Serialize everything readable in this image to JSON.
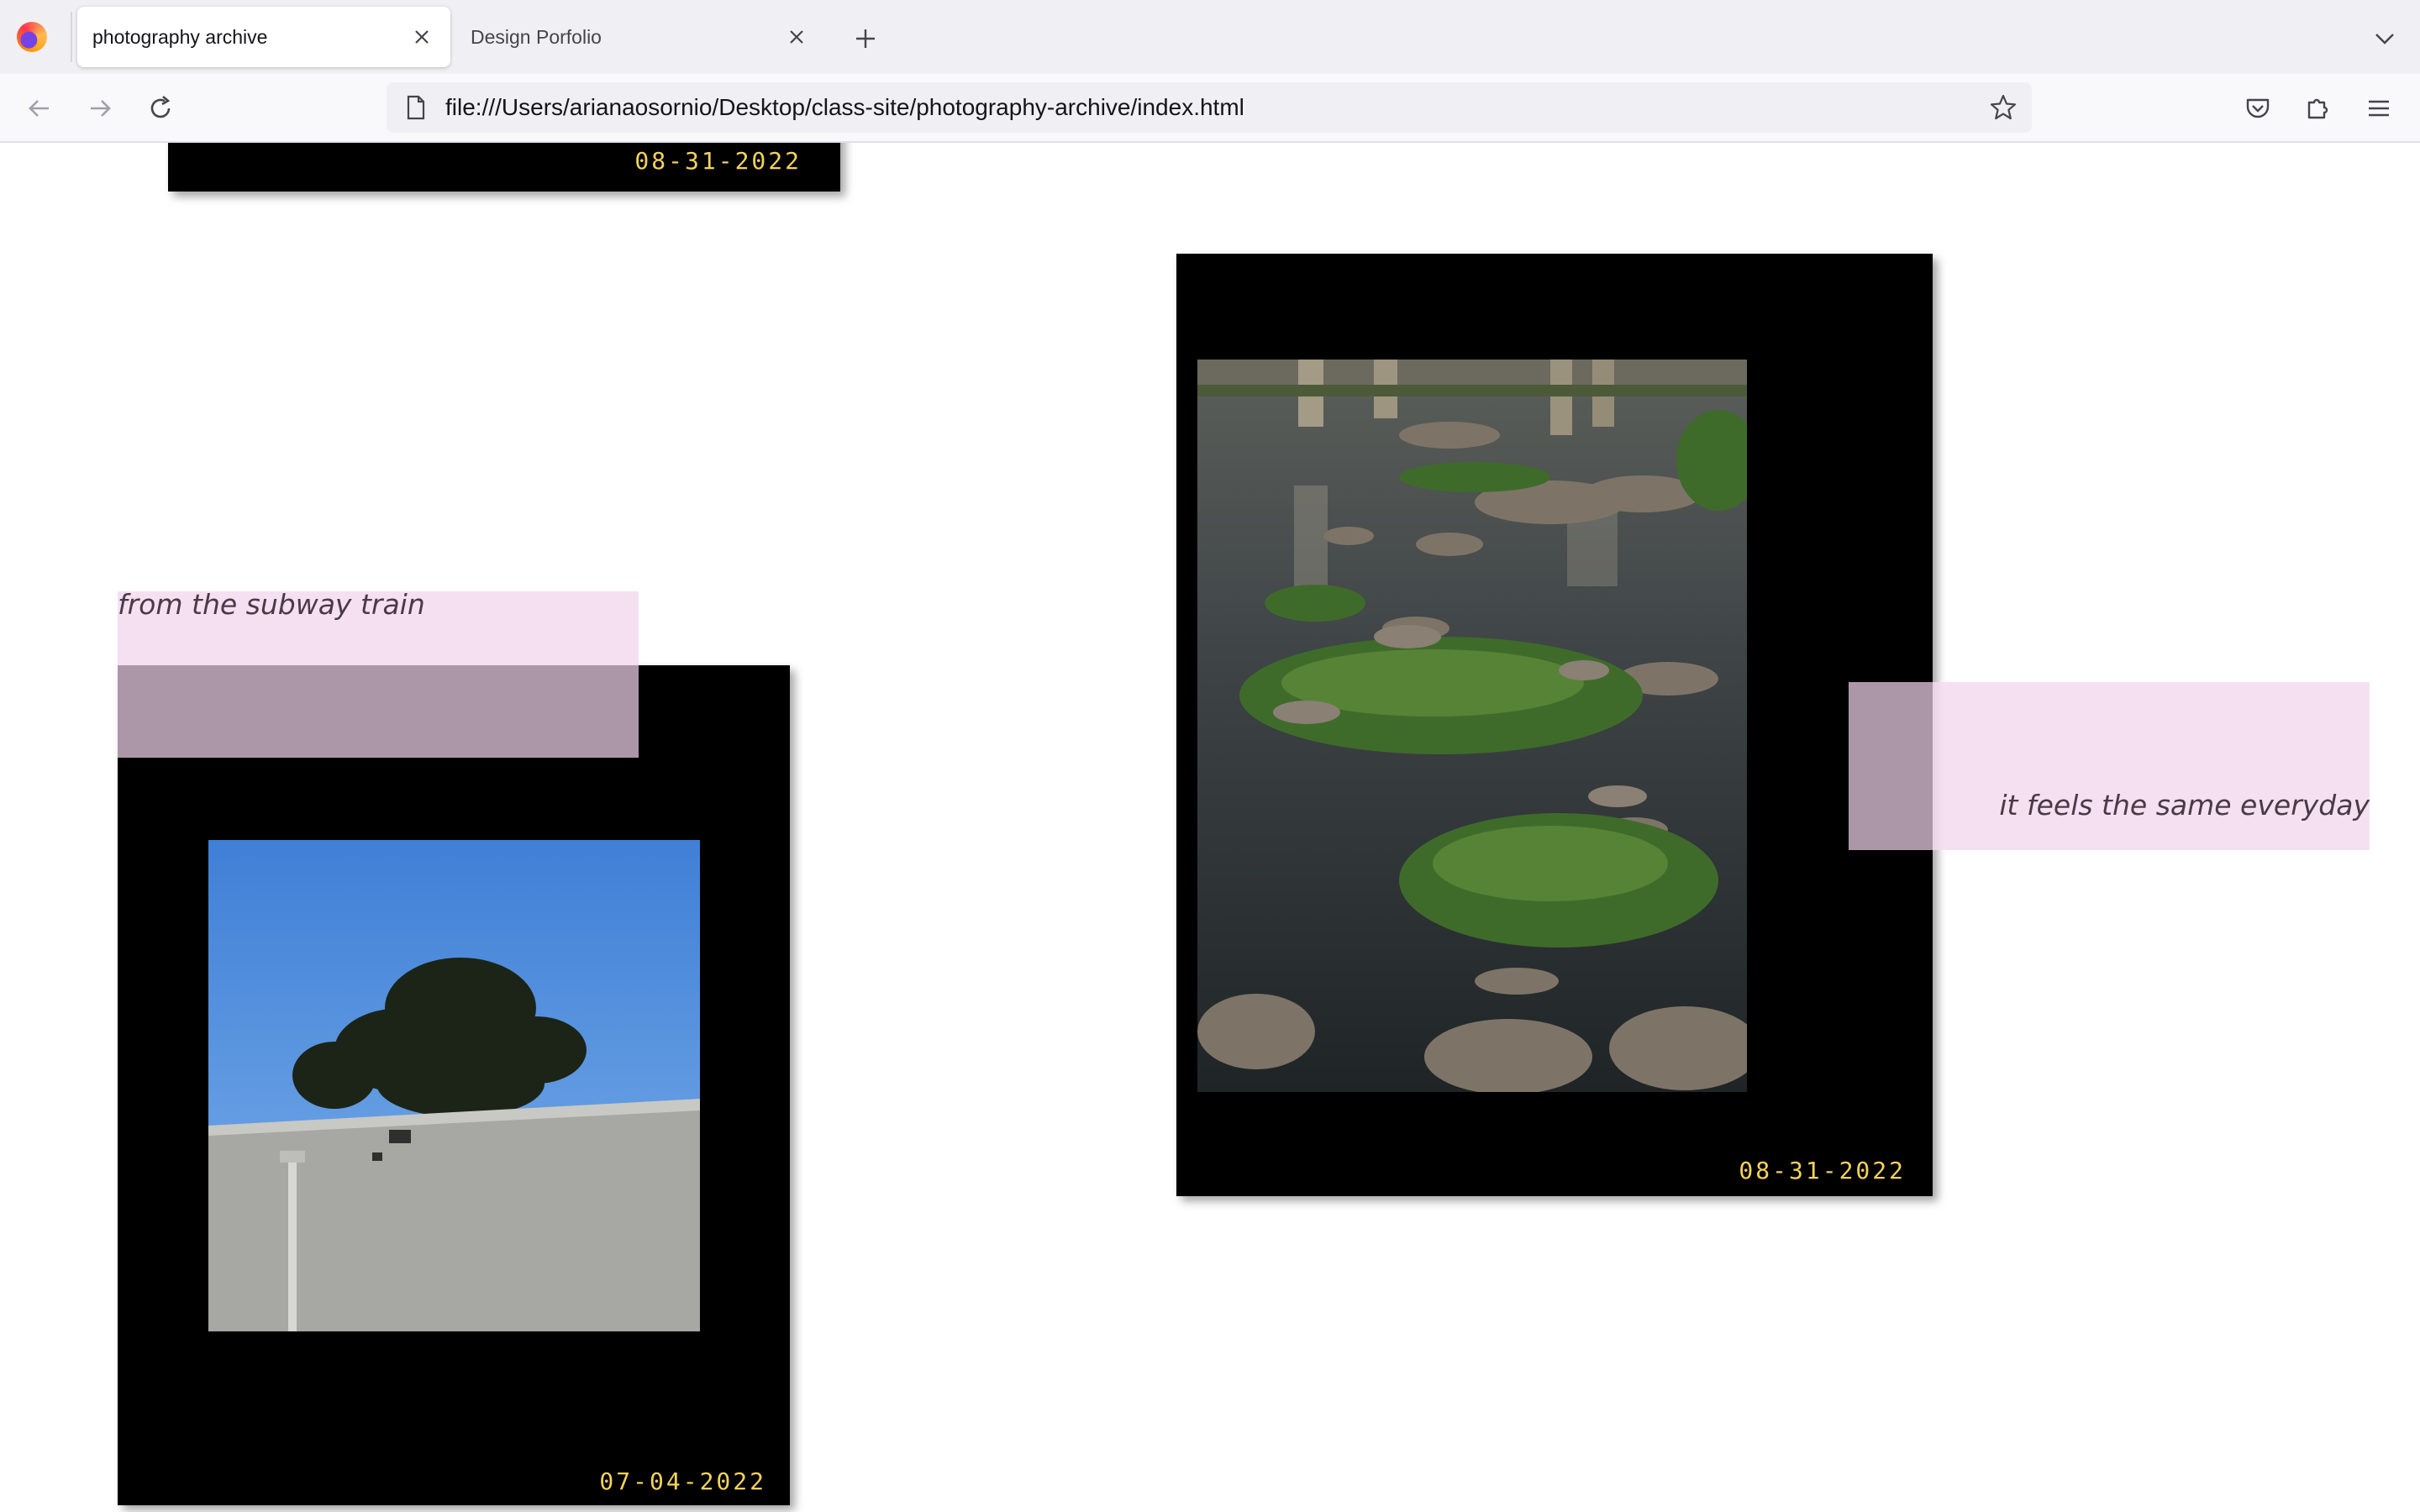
{
  "browser": {
    "tabs": [
      {
        "label": "photography archive",
        "active": true
      },
      {
        "label": "Design Porfolio",
        "active": false
      }
    ],
    "url": "file:///Users/arianaosornio/Desktop/class-site/photography-archive/index.html"
  },
  "page": {
    "top_card": {
      "date": "08-31-2022"
    },
    "river_card": {
      "date": "08-31-2022",
      "caption": "it feels the same everyday",
      "photo": "river-rocks-photo"
    },
    "subway_card": {
      "date": "07-04-2022",
      "caption": "from the subway train",
      "photo": "tree-over-wall-photo"
    }
  },
  "colors": {
    "frame": "#000000",
    "date_text": "#f3d35a",
    "caption_bg": "#f3dbf0",
    "caption_overlap": "#ac97a8",
    "caption_text": "#4a3a46"
  }
}
